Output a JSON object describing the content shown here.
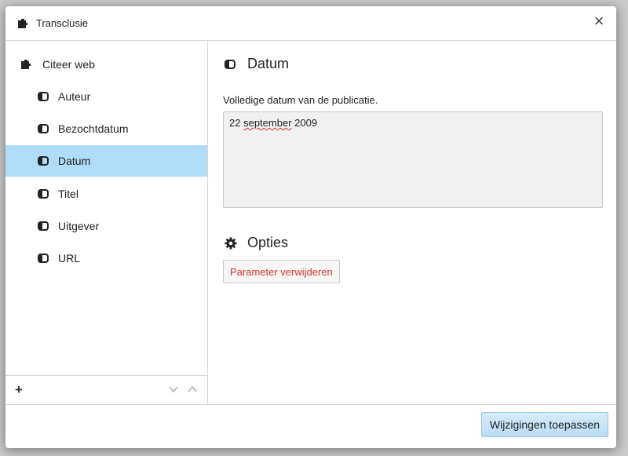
{
  "dialog": {
    "title": "Transclusie",
    "close_glyph": "×"
  },
  "sidebar": {
    "template_label": "Citeer web",
    "params": [
      {
        "label": "Auteur",
        "selected": false
      },
      {
        "label": "Bezochtdatum",
        "selected": false
      },
      {
        "label": "Datum",
        "selected": true
      },
      {
        "label": "Titel",
        "selected": false
      },
      {
        "label": "Uitgever",
        "selected": false
      },
      {
        "label": "URL",
        "selected": false
      }
    ],
    "add_glyph": "+"
  },
  "parameter": {
    "name": "Datum",
    "description": "Volledige datum van de publicatie.",
    "value_day": "22",
    "value_month": "september",
    "value_year": "2009"
  },
  "options": {
    "heading": "Opties",
    "remove_button": "Parameter verwijderen"
  },
  "footer": {
    "apply_button": "Wijzigingen toepassen"
  },
  "colors": {
    "selected_bg": "#aedcf9",
    "destructive": "#dd3333",
    "primary_btn": "#b9dcf5"
  },
  "icons": {
    "template": "puzzle-icon",
    "parameter": "parameter-icon",
    "options": "gear-icon",
    "move_down": "chevron-down-icon",
    "move_up": "chevron-up-icon"
  }
}
